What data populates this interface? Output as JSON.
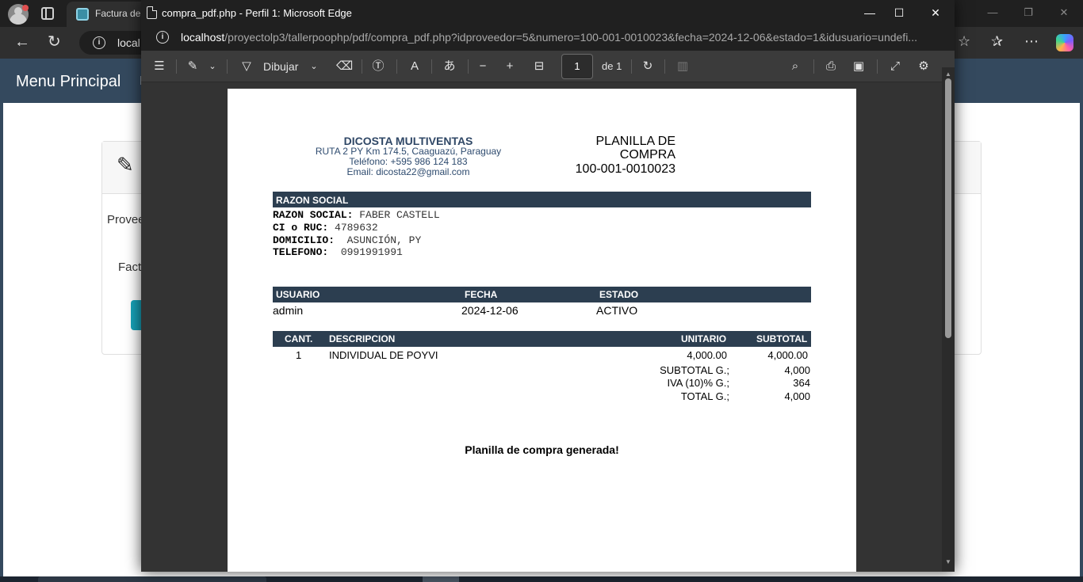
{
  "background_browser": {
    "tab_title": "Factura de",
    "url_partial": "local",
    "nav_title": "Menu Principal",
    "nav_extra": "I",
    "card_label_proveedor": "Provee",
    "card_label_factura": "Fact"
  },
  "popup": {
    "title": "compra_pdf.php - Perfil 1: Microsoft Edge",
    "url_host": "localhost",
    "url_path": "/proyectolp3/tallerpoophp/pdf/compra_pdf.php?idproveedor=5&numero=100-001-0010023&fecha=2024-12-06&estado=1&idusuario=undefi...",
    "toolbar": {
      "draw_label": "Dibujar",
      "page_current": "1",
      "page_total": "de 1"
    }
  },
  "pdf": {
    "company": {
      "name": "DICOSTA MULTIVENTAS",
      "address": "RUTA 2 PY Km 174.5, Caaguazú, Paraguay",
      "phone": "Teléfono: +595 986 124 183",
      "email": "Email: dicosta22@gmail.com"
    },
    "doc_title_line1": "PLANILLA DE",
    "doc_title_line2": "COMPRA",
    "doc_number": "100-001-0010023",
    "razon_social_header": "RAZON SOCIAL",
    "razon_social": {
      "name_label": "RAZON SOCIAL:",
      "name_value": "FABER CASTELL",
      "ruc_label": "CI o RUC:",
      "ruc_value": "4789632",
      "address_label": "DOMICILIO:",
      "address_value": "ASUNCIÓN, PY",
      "phone_label": "TELEFONO:",
      "phone_value": "0991991991"
    },
    "info_headers": {
      "usuario": "USUARIO",
      "fecha": "FECHA",
      "estado": "ESTADO"
    },
    "info_values": {
      "usuario": "admin",
      "fecha": "2024-12-06",
      "estado": "ACTIVO"
    },
    "items_headers": {
      "cant": "CANT.",
      "descripcion": "DESCRIPCION",
      "unitario": "UNITARIO",
      "subtotal": "SUBTOTAL"
    },
    "items": [
      {
        "cant": "1",
        "descripcion": "INDIVIDUAL DE POYVI",
        "unitario": "4,000.00",
        "subtotal": "4,000.00"
      }
    ],
    "totals": {
      "subtotal_label": "SUBTOTAL G.;",
      "subtotal_value": "4,000",
      "iva_label": "IVA (10)% G.;",
      "iva_value": "364",
      "total_label": "TOTAL G.;",
      "total_value": "4,000"
    },
    "footer_message": "Planilla de compra generada!"
  },
  "colors": {
    "pdf_header_bar": "#2c3e50",
    "company_text": "#2d4a6e",
    "bg_navbar": "#34495e",
    "bg_button": "#17a2b8"
  },
  "icons": [
    "list-icon",
    "highlight-icon",
    "draw-icon",
    "eraser-icon",
    "text-box-icon",
    "read-aloud-icon",
    "translate-icon",
    "zoom-out-icon",
    "zoom-in-icon",
    "fit-page-icon",
    "rotate-icon",
    "two-page-icon",
    "search-icon",
    "print-icon",
    "save-icon",
    "fullscreen-icon",
    "settings-icon"
  ]
}
